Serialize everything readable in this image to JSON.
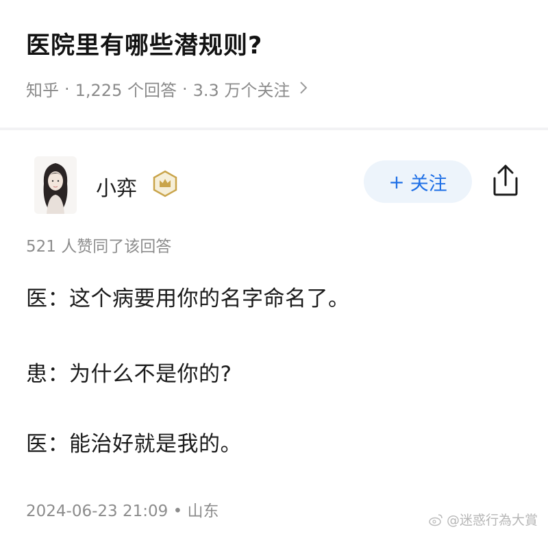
{
  "question": {
    "title": "医院里有哪些潜规则?",
    "source": "知乎",
    "answers": "1,225 个回答",
    "followers": "3.3 万个关注",
    "separator": "·"
  },
  "author": {
    "name": "小弈",
    "follow_label": "关注",
    "follow_plus": "+"
  },
  "answer": {
    "likes": "521 人赞同了该回答",
    "lines": [
      "医：这个病要用你的名字命名了。",
      "患：为什么不是你的?",
      "医：能治好就是我的。"
    ],
    "timestamp": "2024-06-23 21:09",
    "location_sep": "•",
    "location": "山东"
  },
  "watermark": {
    "text": "@迷惑行為大賞"
  },
  "colors": {
    "accent": "#1e6fe6",
    "follow_bg": "#edf4fb",
    "meta_gray": "#8a8a8a",
    "badge_gold": "#c9a44a"
  }
}
